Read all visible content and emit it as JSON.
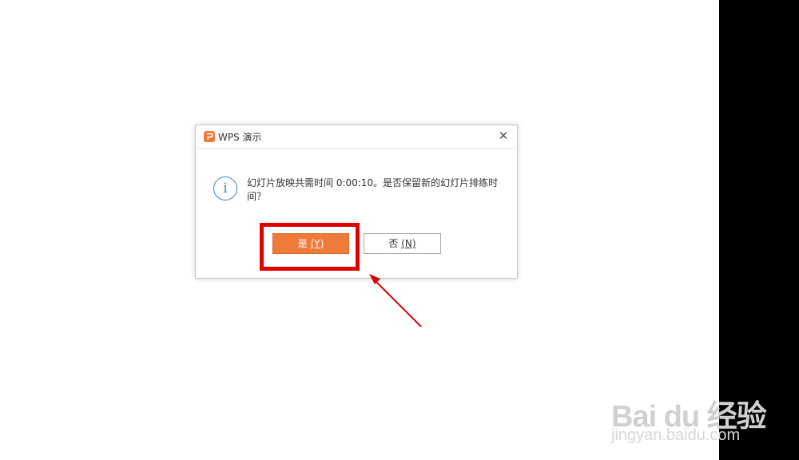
{
  "dialog": {
    "title": "WPS 演示",
    "close_glyph": "✕",
    "info_glyph": "i",
    "message": "幻灯片放映共需时间 0:00:10。是否保留新的幻灯片排练时间？",
    "buttons": {
      "yes_label": "是",
      "yes_key": "(Y)",
      "no_label": "否",
      "no_key": "(N)"
    }
  },
  "watermark": {
    "logo": "Bai du 经验",
    "url": "jingyan.baidu.com"
  },
  "colors": {
    "accent_orange": "#ef7b3b",
    "info_blue": "#3d86c6",
    "highlight_red": "#e00000"
  },
  "icons": [
    "wps-presentation-icon",
    "close-icon",
    "info-icon",
    "arrow-annotation-icon"
  ]
}
